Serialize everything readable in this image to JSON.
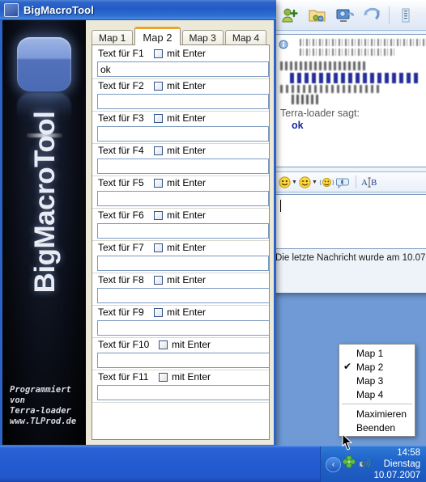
{
  "app": {
    "title": "BigMacroTool",
    "title_icon": "app-window-icon",
    "banner": {
      "vertical_title": "BigMacroTool",
      "credits_lines": [
        "Programmiert",
        "von",
        "Terra-loader",
        "www.TLProd.de"
      ]
    },
    "tabs": [
      {
        "label": "Map 1",
        "active": false
      },
      {
        "label": "Map 2",
        "active": true
      },
      {
        "label": "Map 3",
        "active": false
      },
      {
        "label": "Map 4",
        "active": false
      }
    ],
    "fields": [
      {
        "label": "Text für F1",
        "checkbox_label": "mit Enter",
        "checked": false,
        "value": "ok"
      },
      {
        "label": "Text für F2",
        "checkbox_label": "mit Enter",
        "checked": false,
        "value": ""
      },
      {
        "label": "Text für F3",
        "checkbox_label": "mit Enter",
        "checked": false,
        "value": ""
      },
      {
        "label": "Text für F4",
        "checkbox_label": "mit Enter",
        "checked": false,
        "value": ""
      },
      {
        "label": "Text für F5",
        "checkbox_label": "mit Enter",
        "checked": false,
        "value": ""
      },
      {
        "label": "Text für F6",
        "checkbox_label": "mit Enter",
        "checked": false,
        "value": ""
      },
      {
        "label": "Text für F7",
        "checkbox_label": "mit Enter",
        "checked": false,
        "value": ""
      },
      {
        "label": "Text für F8",
        "checkbox_label": "mit Enter",
        "checked": false,
        "value": ""
      },
      {
        "label": "Text für F9",
        "checkbox_label": "mit Enter",
        "checked": false,
        "value": ""
      },
      {
        "label": "Text für F10",
        "checkbox_label": "mit Enter",
        "checked": false,
        "value": ""
      },
      {
        "label": "Text für F11",
        "checkbox_label": "mit Enter",
        "checked": false,
        "value": ""
      }
    ]
  },
  "context_menu": {
    "items": [
      {
        "label": "Map 1",
        "checked": false
      },
      {
        "label": "Map 2",
        "checked": true
      },
      {
        "label": "Map 3",
        "checked": false
      },
      {
        "label": "Map 4",
        "checked": false
      },
      {
        "separator": true
      },
      {
        "label": "Maximieren",
        "checked": false
      },
      {
        "label": "Beenden",
        "checked": false
      }
    ],
    "check_glyph": "✔"
  },
  "chat": {
    "toolbar_icons": [
      "add-contact-icon",
      "send-file-icon",
      "webcam-icon",
      "voice-call-icon",
      "more-icon"
    ],
    "history": {
      "sender": "Terra-loader sagt:",
      "message": "ok"
    },
    "emoticon_bar": {
      "smiley": "smiley-icon",
      "wink": "wink-smiley-icon",
      "nudge": "nudge-icon",
      "sound": "sound-icon",
      "format": "AB"
    },
    "compose_placeholder": "",
    "compose_value": "",
    "status": "Die letzte Nachricht wurde am 10.07."
  },
  "taskbar": {
    "tray_arrow": "‹",
    "tray_icons": [
      "network-icon",
      "volume-icon"
    ],
    "clock": {
      "time": "14:58",
      "weekday": "Dienstag",
      "date": "10.07.2007"
    }
  },
  "colors": {
    "titlebar": "#225cc6",
    "taskbar": "#245bd2",
    "tab_active_accent": "#f0a32a",
    "app_face": "#ece9d8",
    "chat_message": "#152a9c"
  }
}
